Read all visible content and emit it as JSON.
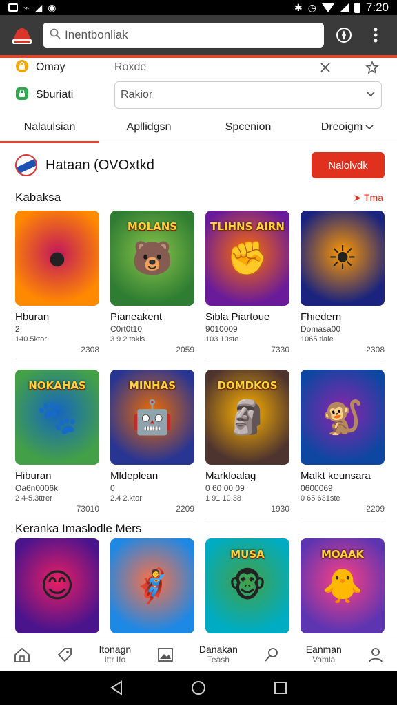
{
  "status_bar": {
    "time": "7:20"
  },
  "app_bar": {
    "search_value": "Inentbonliak"
  },
  "filters": [
    {
      "label": "Omay",
      "value": "Roxde"
    },
    {
      "label": "Sburiati",
      "value": "Rakior"
    }
  ],
  "tabs": [
    {
      "label": "Nalaulsian",
      "active": true
    },
    {
      "label": "Apllidgsn",
      "active": false
    },
    {
      "label": "Spcenion",
      "active": false
    },
    {
      "label": "Dreoigm",
      "active": false
    }
  ],
  "promo": {
    "title": "Hataan (OVOxtkd",
    "button_label": "Nalolvdk"
  },
  "sections": [
    {
      "title": "Kabaksa",
      "link": "Tma",
      "cards": [
        {
          "title": "Hburan",
          "subtitle": "2",
          "meta": "140.5ktor",
          "count": "2308",
          "colors": [
            "#ff8a00",
            "#c2185b"
          ],
          "glyph": "●",
          "banner": ""
        },
        {
          "title": "Pianeakent",
          "subtitle": "C0rt0t10",
          "meta": "3 9 2 tokis",
          "count": "2059",
          "colors": [
            "#2e7d32",
            "#8bc34a"
          ],
          "glyph": "🐻",
          "banner": "MOLANS"
        },
        {
          "title": "Sibla Piartoue",
          "subtitle": "9010009",
          "meta": "103 10ste",
          "count": "7330",
          "colors": [
            "#6a1b9a",
            "#ff6f00"
          ],
          "glyph": "✊",
          "banner": "TLIHNS AIRN"
        },
        {
          "title": "Fhiedern",
          "subtitle": "Domasa00",
          "meta": "1065 tiale",
          "count": "2308",
          "colors": [
            "#1a237e",
            "#ff9800"
          ],
          "glyph": "☀",
          "banner": ""
        }
      ]
    },
    {
      "title": "",
      "link": "",
      "cards": [
        {
          "title": "Hiburan",
          "subtitle": "Oa6n0006k",
          "meta": "2 4-5.3ttrer",
          "count": "73010",
          "colors": [
            "#43a047",
            "#1565c0"
          ],
          "glyph": "🐾",
          "banner": "NOKAHAS"
        },
        {
          "title": "Mldeplean",
          "subtitle": "0",
          "meta": "2.4 2.ktor",
          "count": "2209",
          "colors": [
            "#283593",
            "#ef6c00"
          ],
          "glyph": "🤖",
          "banner": "MINHAS"
        },
        {
          "title": "Markloalag",
          "subtitle": "0 60 00 09",
          "meta": "1 91 10.38",
          "count": "1930",
          "colors": [
            "#4e342e",
            "#ffb300"
          ],
          "glyph": "🗿",
          "banner": "DOMDKOS"
        },
        {
          "title": "Malkt keunsara",
          "subtitle": "0600069",
          "meta": "0 65 631ste",
          "count": "2209",
          "colors": [
            "#0d47a1",
            "#8e24aa"
          ],
          "glyph": "🐒",
          "banner": ""
        }
      ]
    },
    {
      "title": "Keranka Imaslodle Mers",
      "link": "",
      "cards": [
        {
          "title": "",
          "subtitle": "",
          "meta": "",
          "count": "",
          "colors": [
            "#4a148c",
            "#e91e63"
          ],
          "glyph": "😊",
          "banner": ""
        },
        {
          "title": "",
          "subtitle": "",
          "meta": "",
          "count": "",
          "colors": [
            "#1e88e5",
            "#ff7043"
          ],
          "glyph": "🦸",
          "banner": ""
        },
        {
          "title": "",
          "subtitle": "",
          "meta": "",
          "count": "",
          "colors": [
            "#00acc1",
            "#43a047"
          ],
          "glyph": "🐵",
          "banner": "MUSA"
        },
        {
          "title": "",
          "subtitle": "",
          "meta": "",
          "count": "",
          "colors": [
            "#5e35b1",
            "#ff4081"
          ],
          "glyph": "🐥",
          "banner": "MOAAK"
        }
      ]
    }
  ],
  "bottom_nav": [
    {
      "icon": "home-icon",
      "label": "",
      "sub": ""
    },
    {
      "icon": "tag-icon",
      "label": "",
      "sub": ""
    },
    {
      "icon": "",
      "label": "Itonagn",
      "sub": "Ittr Ifo"
    },
    {
      "icon": "image-icon",
      "label": "",
      "sub": ""
    },
    {
      "icon": "",
      "label": "Danakan",
      "sub": "Teash"
    },
    {
      "icon": "search-icon",
      "label": "",
      "sub": ""
    },
    {
      "icon": "",
      "label": "Eanman",
      "sub": "Vamla"
    },
    {
      "icon": "profile-icon",
      "label": "",
      "sub": ""
    }
  ],
  "theme": {
    "accent": "#e0301e",
    "appbar": "#3a3a3a"
  }
}
